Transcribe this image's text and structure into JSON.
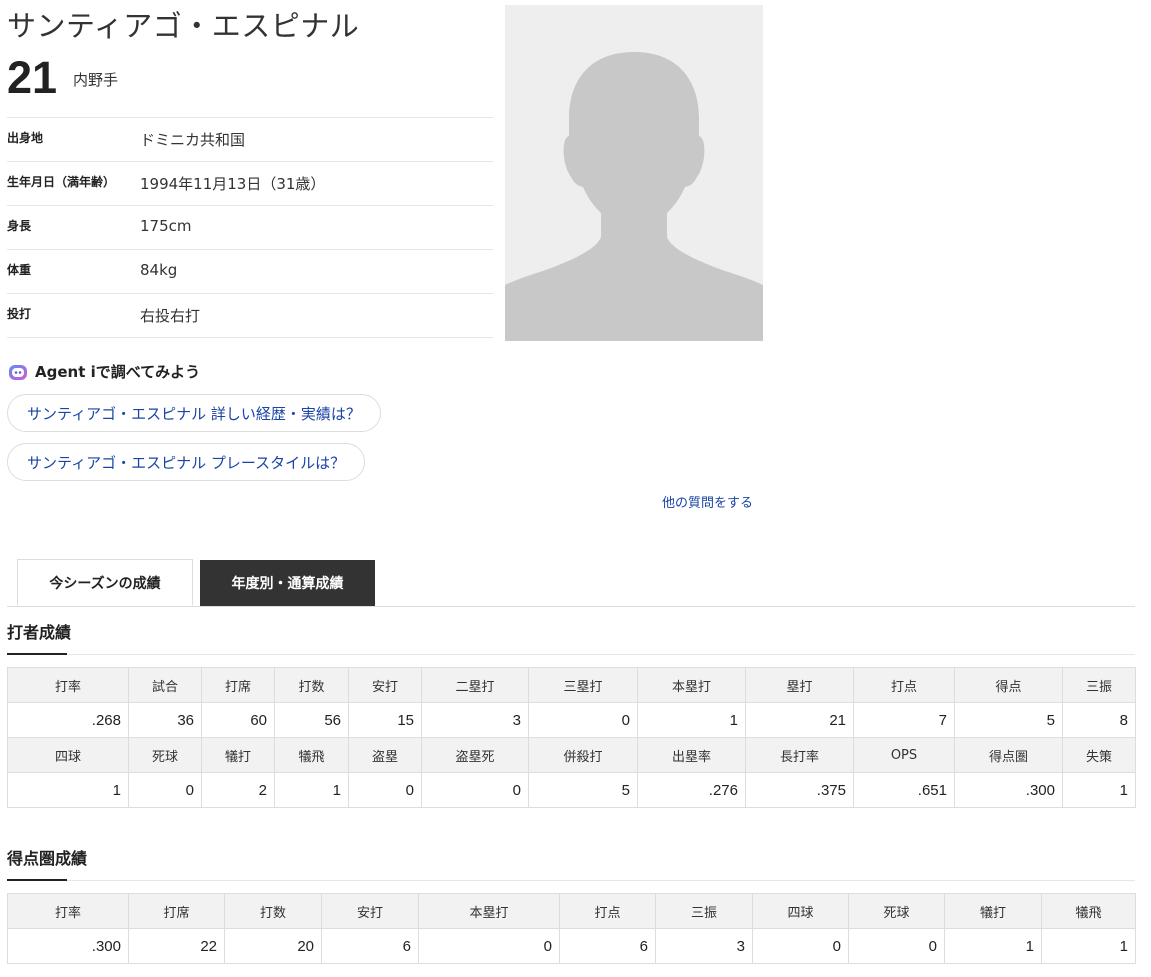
{
  "player": {
    "name": "サンティアゴ・エスピナル",
    "number": "21",
    "position": "内野手"
  },
  "profile": [
    {
      "label": "出身地",
      "value": "ドミニカ共和国"
    },
    {
      "label": "生年月日（満年齢）",
      "value": "1994年11月13日（31歳）"
    },
    {
      "label": "身長",
      "value": "175cm"
    },
    {
      "label": "体重",
      "value": "84kg"
    },
    {
      "label": "投打",
      "value": "右投右打"
    }
  ],
  "agent": {
    "title": "Agent iで調べてみよう",
    "questions": [
      "サンティアゴ・エスピナル 詳しい経歴・実績は？",
      "サンティアゴ・エスピナル プレースタイルは？"
    ],
    "more_link": "他の質問をする"
  },
  "tabs": [
    "今シーズンの成績",
    "年度別・通算成績"
  ],
  "batting": {
    "title": "打者成績",
    "headers1": [
      "打率",
      "試合",
      "打席",
      "打数",
      "安打",
      "二塁打",
      "三塁打",
      "本塁打",
      "塁打",
      "打点",
      "得点",
      "三振"
    ],
    "values1": [
      ".268",
      "36",
      "60",
      "56",
      "15",
      "3",
      "0",
      "1",
      "21",
      "7",
      "5",
      "8"
    ],
    "headers2": [
      "四球",
      "死球",
      "犠打",
      "犠飛",
      "盗塁",
      "盗塁死",
      "併殺打",
      "出塁率",
      "長打率",
      "OPS",
      "得点圏",
      "失策"
    ],
    "values2": [
      "1",
      "0",
      "2",
      "1",
      "0",
      "0",
      "5",
      ".276",
      ".375",
      ".651",
      ".300",
      "1"
    ]
  },
  "risp": {
    "title": "得点圏成績",
    "headers": [
      "打率",
      "打席",
      "打数",
      "安打",
      "本塁打",
      "打点",
      "三振",
      "四球",
      "死球",
      "犠打",
      "犠飛"
    ],
    "values": [
      ".300",
      "22",
      "20",
      "6",
      "0",
      "6",
      "3",
      "0",
      "0",
      "1",
      "1"
    ]
  }
}
